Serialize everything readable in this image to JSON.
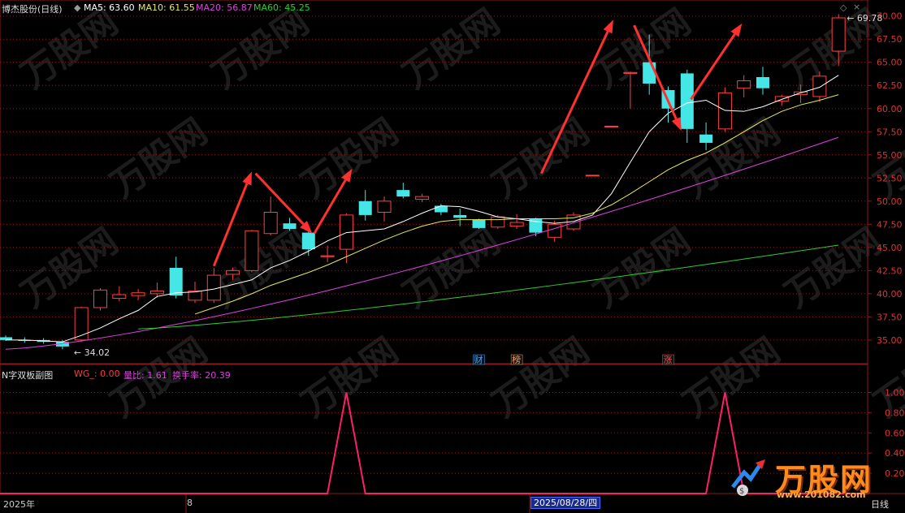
{
  "main_header": {
    "title": "博杰股份(日线)",
    "ma5": "MA5: 63.60",
    "ma10": "MA10: 61.55",
    "ma20": "MA20: 56.87",
    "ma60": "MA60: 45.25"
  },
  "sub_header": {
    "title": "N字双板副图",
    "wg": "WG_: 0.00",
    "liangbi": "量比: 1.61",
    "huanshou": "换手率: 20.39"
  },
  "bottom_axis": {
    "year_label": "2025年",
    "month_label": "8",
    "date_box": "2025/08/28/四",
    "period_label": "日线"
  },
  "event_badges": [
    {
      "text": "财",
      "color": "#4aa3ff",
      "index": 25
    },
    {
      "text": "榜",
      "color": "#ff9a55",
      "index": 27
    },
    {
      "text": "涨",
      "color": "#ff4b4b",
      "index": 35
    }
  ],
  "watermark": {
    "brand": "万股网",
    "site": "www.201082.com"
  },
  "colors": {
    "up": "#ff4040",
    "down": "#44e6e6",
    "ma5": "#ffffff",
    "ma10": "#e8e85a",
    "ma20": "#e040e0",
    "ma60": "#2ecc2e",
    "grid": "#8b1a1a",
    "signal": "#ff1e6e",
    "arrow": "#ff3030"
  },
  "chart_data": [
    {
      "type": "candlestick",
      "title": "博杰股份(日线)",
      "ylim": [
        33.5,
        70.5
      ],
      "yticks": [
        "70.00",
        "67.50",
        "65.00",
        "62.50",
        "60.00",
        "57.50",
        "55.00",
        "52.50",
        "50.00",
        "47.50",
        "45.00",
        "42.50",
        "40.00",
        "37.50",
        "35.00"
      ],
      "annotations": {
        "low_label": "34.02",
        "high_label": "69.78"
      },
      "candles": [
        {
          "o": 35.3,
          "h": 35.5,
          "l": 34.9,
          "c": 35.0
        },
        {
          "o": 35.0,
          "h": 35.3,
          "l": 34.7,
          "c": 34.9
        },
        {
          "o": 35.0,
          "h": 35.2,
          "l": 34.6,
          "c": 34.8
        },
        {
          "o": 34.8,
          "h": 35.0,
          "l": 34.0,
          "c": 34.3
        },
        {
          "o": 35.0,
          "h": 38.6,
          "l": 34.8,
          "c": 38.5
        },
        {
          "o": 38.5,
          "h": 40.6,
          "l": 38.2,
          "c": 40.4
        },
        {
          "o": 39.5,
          "h": 40.8,
          "l": 39.2,
          "c": 39.9
        },
        {
          "o": 39.8,
          "h": 40.5,
          "l": 39.3,
          "c": 40.1
        },
        {
          "o": 40.0,
          "h": 41.2,
          "l": 39.6,
          "c": 40.3
        },
        {
          "o": 42.8,
          "h": 44.0,
          "l": 39.5,
          "c": 39.8
        },
        {
          "o": 39.3,
          "h": 41.3,
          "l": 39.0,
          "c": 40.3
        },
        {
          "o": 39.3,
          "h": 42.8,
          "l": 39.0,
          "c": 42.0
        },
        {
          "o": 42.1,
          "h": 42.8,
          "l": 41.5,
          "c": 42.5
        },
        {
          "o": 42.5,
          "h": 46.9,
          "l": 42.3,
          "c": 46.8
        },
        {
          "o": 46.5,
          "h": 50.5,
          "l": 46.3,
          "c": 48.8
        },
        {
          "o": 47.6,
          "h": 48.2,
          "l": 46.8,
          "c": 47.0
        },
        {
          "o": 46.6,
          "h": 46.8,
          "l": 44.1,
          "c": 44.8
        },
        {
          "o": 44.0,
          "h": 45.2,
          "l": 43.4,
          "c": 44.1
        },
        {
          "o": 44.8,
          "h": 48.7,
          "l": 43.3,
          "c": 48.5
        },
        {
          "o": 50.0,
          "h": 51.2,
          "l": 47.9,
          "c": 48.5
        },
        {
          "o": 48.8,
          "h": 50.5,
          "l": 47.8,
          "c": 50.0
        },
        {
          "o": 51.2,
          "h": 52.0,
          "l": 50.3,
          "c": 50.5
        },
        {
          "o": 50.2,
          "h": 50.8,
          "l": 49.9,
          "c": 50.5
        },
        {
          "o": 49.5,
          "h": 49.7,
          "l": 48.5,
          "c": 48.8
        },
        {
          "o": 48.5,
          "h": 49.2,
          "l": 47.3,
          "c": 48.2
        },
        {
          "o": 48.0,
          "h": 48.1,
          "l": 47.0,
          "c": 47.1
        },
        {
          "o": 47.2,
          "h": 48.5,
          "l": 47.0,
          "c": 48.3
        },
        {
          "o": 47.3,
          "h": 48.6,
          "l": 47.0,
          "c": 47.7
        },
        {
          "o": 48.1,
          "h": 48.2,
          "l": 46.2,
          "c": 46.6
        },
        {
          "o": 46.1,
          "h": 47.9,
          "l": 45.6,
          "c": 47.5
        },
        {
          "o": 47.0,
          "h": 48.8,
          "l": 46.8,
          "c": 48.5
        },
        {
          "o": 52.8,
          "h": 52.8,
          "l": 52.8,
          "c": 52.8
        },
        {
          "o": 58.1,
          "h": 58.1,
          "l": 58.1,
          "c": 58.1
        },
        {
          "o": 63.8,
          "h": 64.0,
          "l": 60.0,
          "c": 63.9
        },
        {
          "o": 65.0,
          "h": 68.0,
          "l": 61.5,
          "c": 62.7
        },
        {
          "o": 62.0,
          "h": 62.4,
          "l": 58.5,
          "c": 60.0
        },
        {
          "o": 63.8,
          "h": 64.2,
          "l": 56.3,
          "c": 57.8
        },
        {
          "o": 57.2,
          "h": 58.5,
          "l": 55.5,
          "c": 56.3
        },
        {
          "o": 57.8,
          "h": 62.3,
          "l": 57.5,
          "c": 61.7
        },
        {
          "o": 62.2,
          "h": 63.6,
          "l": 61.2,
          "c": 63.0
        },
        {
          "o": 63.4,
          "h": 64.5,
          "l": 61.5,
          "c": 62.2
        },
        {
          "o": 60.8,
          "h": 61.5,
          "l": 60.3,
          "c": 61.3
        },
        {
          "o": 61.5,
          "h": 62.6,
          "l": 60.6,
          "c": 61.8
        },
        {
          "o": 61.3,
          "h": 64.0,
          "l": 60.7,
          "c": 63.5
        },
        {
          "o": 66.2,
          "h": 70.2,
          "l": 64.6,
          "c": 69.8
        }
      ],
      "ma5": [
        35.0,
        35.0,
        34.9,
        34.8,
        35.5,
        36.3,
        37.3,
        38.2,
        39.7,
        40.1,
        40.2,
        40.5,
        41.0,
        41.5,
        42.8,
        43.6,
        44.6,
        45.7,
        46.6,
        46.8,
        47.0,
        47.8,
        48.7,
        49.5,
        49.4,
        48.9,
        48.3,
        48.1,
        47.8,
        47.6,
        47.8,
        48.5,
        50.8,
        54.2,
        57.5,
        59.5,
        60.6,
        60.9,
        59.8,
        59.7,
        60.2,
        61.0,
        61.7,
        62.3,
        63.6
      ],
      "ma10": [
        null,
        null,
        null,
        null,
        null,
        null,
        null,
        null,
        null,
        null,
        37.8,
        38.5,
        39.2,
        40.0,
        40.9,
        41.6,
        42.3,
        43.1,
        44.0,
        44.9,
        45.8,
        46.6,
        47.3,
        47.8,
        48.0,
        48.0,
        48.0,
        48.1,
        48.1,
        48.1,
        48.2,
        48.7,
        49.6,
        50.8,
        52.1,
        53.4,
        54.4,
        55.2,
        56.3,
        57.5,
        58.7,
        59.7,
        60.4,
        60.9,
        61.5
      ],
      "ma20": [
        null,
        null,
        null,
        null,
        null,
        null,
        null,
        null,
        null,
        null,
        null,
        null,
        null,
        null,
        null,
        null,
        null,
        null,
        null,
        null,
        null,
        null,
        null,
        null,
        null,
        null,
        null,
        null,
        null,
        null,
        null,
        null,
        null,
        null,
        null,
        null,
        null,
        null,
        null,
        null,
        null,
        null,
        null,
        null,
        56.9
      ],
      "ma60": [
        null,
        null,
        null,
        null,
        null,
        null,
        null,
        null,
        null,
        null,
        null,
        null,
        null,
        null,
        null,
        null,
        null,
        null,
        null,
        null,
        null,
        null,
        null,
        null,
        null,
        null,
        null,
        null,
        null,
        null,
        null,
        null,
        null,
        null,
        null,
        null,
        null,
        null,
        null,
        null,
        null,
        null,
        null,
        null,
        45.25
      ]
    },
    {
      "type": "line",
      "title": "N字双板副图",
      "ylim": [
        0,
        1.1
      ],
      "yticks": [
        "1.00",
        "0.80",
        "0.60",
        "0.40",
        "0.20"
      ],
      "series": [
        {
          "name": "WG_",
          "values": [
            0,
            0,
            0,
            0,
            0,
            0,
            0,
            0,
            0,
            0,
            0,
            0,
            0,
            0,
            0,
            0,
            0,
            0,
            1,
            0,
            0,
            0,
            0,
            0,
            0,
            0,
            0,
            0,
            0,
            0,
            0,
            0,
            0,
            0,
            0,
            0,
            0,
            0,
            1,
            0,
            0,
            0,
            0,
            0,
            0
          ]
        }
      ]
    }
  ]
}
